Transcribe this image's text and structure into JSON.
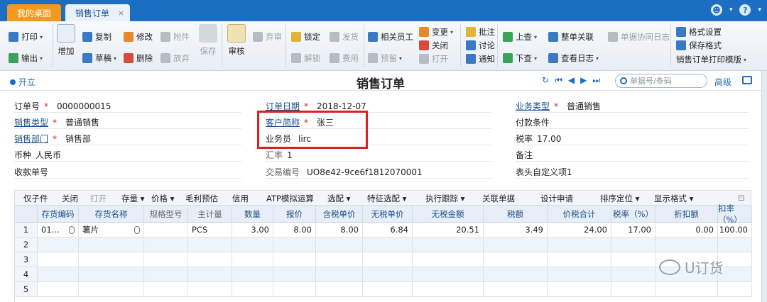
{
  "tabs": {
    "home": "我的桌面",
    "active": "销售订单",
    "close": "×"
  },
  "topright": {
    "user": "☻",
    "help": "?",
    "caret": "▾"
  },
  "toolbar": {
    "print": "打印",
    "export": "输出",
    "add": "增加",
    "copy": "复制",
    "draft": "草稿",
    "edit": "修改",
    "delete": "删除",
    "attach": "附件",
    "abandon": "放弃",
    "save": "保存",
    "audit": "审核",
    "discard": "弃审",
    "lock": "锁定",
    "unlock": "解锁",
    "ship": "发货",
    "cost": "费用",
    "related_staff": "相关员工",
    "preorder": "预留",
    "change": "变更",
    "close": "关闭",
    "open": "打开",
    "note": "批注",
    "discuss": "讨论",
    "notify": "通知",
    "up": "上查",
    "down": "下查",
    "assoc": "整单关联",
    "view_log": "查看日志",
    "collab_log": "单据协同日志",
    "format_set": "格式设置",
    "save_format": "保存格式",
    "print_template": "销售订单打印模版"
  },
  "title": {
    "open": "开立",
    "main": "销售订单",
    "search_placeholder": "单据号/条码",
    "advanced": "高级"
  },
  "form": {
    "order_no": {
      "label": "订单号",
      "value": "0000000015"
    },
    "order_date": {
      "label": "订单日期",
      "value": "2018-12-07"
    },
    "biz_type": {
      "label": "业务类型",
      "value": "普通销售"
    },
    "sales_type": {
      "label": "销售类型",
      "value": "普通销售"
    },
    "customer": {
      "label": "客户简称",
      "value": "张三"
    },
    "pay_terms": {
      "label": "付款条件",
      "value": ""
    },
    "dept": {
      "label": "销售部门",
      "value": "销售部"
    },
    "salesman": {
      "label": "业务员",
      "value": "lirc"
    },
    "tax_rate": {
      "label": "税率",
      "value": "17.00"
    },
    "currency": {
      "label": "币种",
      "value": "人民币"
    },
    "rate": {
      "label": "汇率",
      "value": "1"
    },
    "remark": {
      "label": "备注",
      "value": ""
    },
    "receipt_no": {
      "label": "收款单号",
      "value": ""
    },
    "trade_no": {
      "label": "交易编号",
      "value": "UO8e42-9ce6f1812070001"
    },
    "custom1": {
      "label": "表头自定义项1",
      "value": ""
    },
    "req": "*"
  },
  "gridbar": {
    "copy_row": "仅子件",
    "close": "关闭",
    "open": "打开",
    "stock": "存量",
    "price": "价格",
    "margin": "毛利预估",
    "credit": "信用",
    "atp": "ATP模拟运算",
    "pick": "选配",
    "feature": "特征选配",
    "track": "执行跟踪",
    "assoc": "关联单据",
    "design": "设计申请",
    "sort": "排序定位",
    "display": "显示格式"
  },
  "grid": {
    "headers": [
      "存货编码",
      "存货名称",
      "规格型号",
      "主计量",
      "数量",
      "报价",
      "含税单价",
      "无税单价",
      "无税金额",
      "税额",
      "价税合计",
      "税率（%）",
      "折扣额",
      "扣率（%）"
    ],
    "rows": [
      {
        "n": "1",
        "code": "01...",
        "name": "薯片",
        "spec": "",
        "unit": "PCS",
        "qty": "3.00",
        "quote": "8.00",
        "tax_price": "8.00",
        "notax_price": "6.84",
        "notax_amt": "20.51",
        "tax": "3.49",
        "total": "24.00",
        "rate": "17.00",
        "disc": "0.00",
        "disc_rate": "100.00"
      }
    ],
    "empty_rows": [
      "2",
      "3",
      "4",
      "5"
    ]
  },
  "watermark": "U订货",
  "colors": {
    "brand": "#1b6ec2",
    "highlight": "#e02020"
  }
}
